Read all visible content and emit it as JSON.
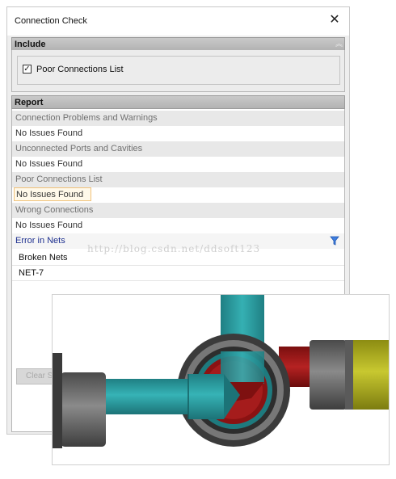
{
  "dialog": {
    "title": "Connection Check",
    "close_label": "✕"
  },
  "include": {
    "title": "Include",
    "checkbox_label": "Poor Connections List",
    "checked": true
  },
  "report": {
    "title": "Report",
    "rows": [
      {
        "kind": "header",
        "text": "Connection Problems and Warnings"
      },
      {
        "kind": "value",
        "text": "No Issues Found"
      },
      {
        "kind": "header",
        "text": "Unconnected Ports and Cavities"
      },
      {
        "kind": "value",
        "text": "No Issues Found"
      },
      {
        "kind": "header",
        "text": "Poor Connections List"
      },
      {
        "kind": "highlight",
        "text": "No Issues Found"
      },
      {
        "kind": "header",
        "text": "Wrong Connections"
      },
      {
        "kind": "value",
        "text": "No Issues Found"
      }
    ],
    "nets_header": "Error in Nets",
    "nets": [
      "Broken Nets",
      "NET-7"
    ]
  },
  "clear_button_label": "Clear S",
  "watermark": "http://blog.csdn.net/ddsoft123",
  "colors": {
    "pipe_teal": "#2a9a9e",
    "fitting_red": "#a31a1a",
    "band_yellow": "#b3b31e",
    "steel_gray": "#5b5b5b"
  }
}
